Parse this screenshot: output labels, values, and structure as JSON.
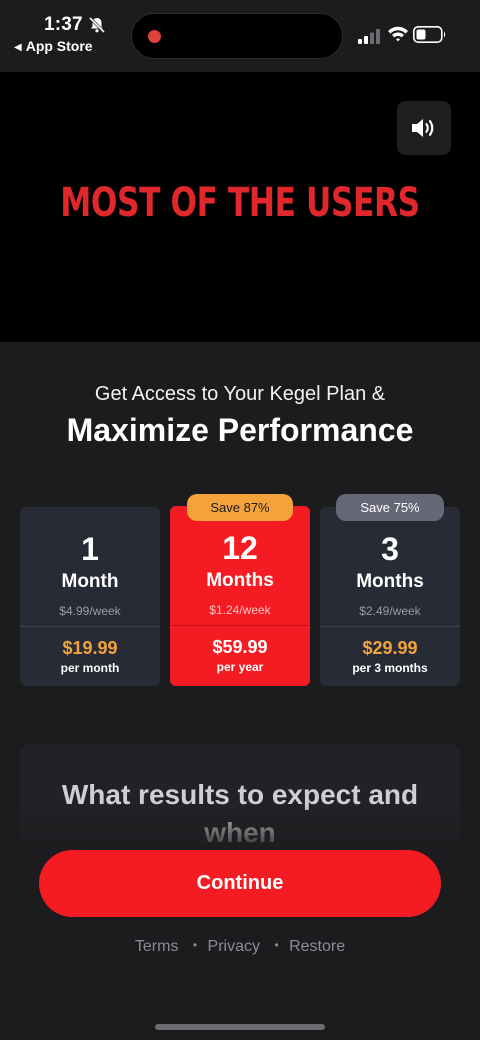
{
  "status_bar": {
    "time": "1:37",
    "back_label": "App Store",
    "icons": [
      "bell-slash-icon",
      "signal-icon",
      "wifi-icon",
      "battery-icon"
    ]
  },
  "video": {
    "headline": "MOST OF THE USERS",
    "sound_icon": "speaker-icon",
    "headline_color": "#e0272b"
  },
  "header": {
    "subtitle": "Get Access to Your Kegel Plan &",
    "title": "Maximize Performance"
  },
  "plans": [
    {
      "num": "1",
      "unit": "Month",
      "weekly": "$4.99/week",
      "price": "$19.99",
      "period": "per month",
      "badge": ""
    },
    {
      "num": "12",
      "unit": "Months",
      "weekly": "$1.24/week",
      "price": "$59.99",
      "period": "per year",
      "badge": "Save 87%"
    },
    {
      "num": "3",
      "unit": "Months",
      "weekly": "$2.49/week",
      "price": "$29.99",
      "period": "per 3 months",
      "badge": "Save 75%"
    }
  ],
  "selected_plan_index": 1,
  "results": {
    "title_line1": "What results to expect and",
    "title_line2": "when"
  },
  "continue_label": "Continue",
  "footer": {
    "terms": "Terms",
    "privacy": "Privacy",
    "restore": "Restore",
    "separator": "•"
  },
  "colors": {
    "accent": "#f41c22",
    "price_orange": "#f3a33a",
    "background": "#1c1c1f",
    "card": "#272b35"
  }
}
